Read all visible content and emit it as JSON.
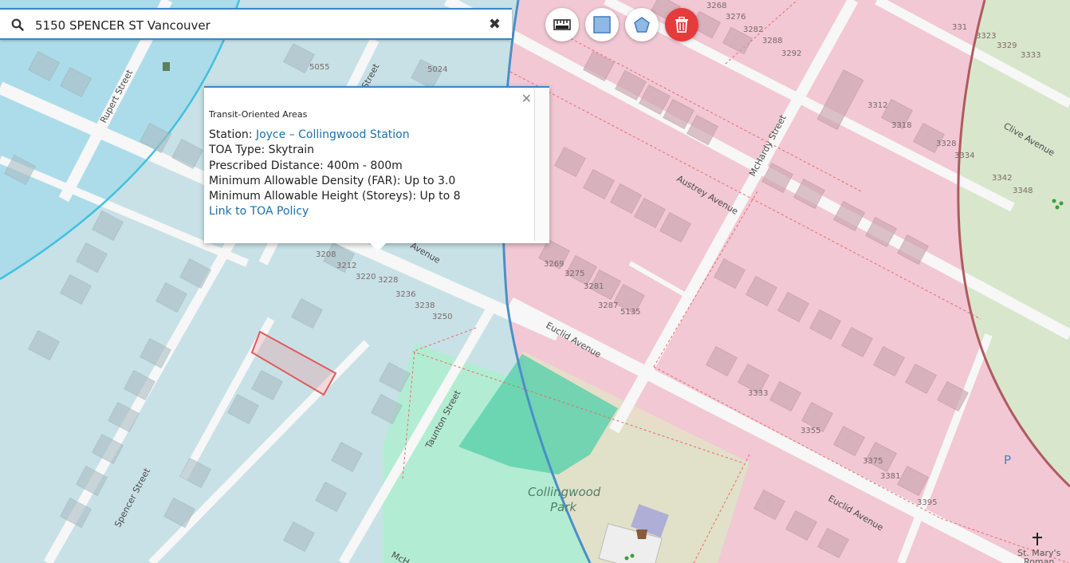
{
  "search": {
    "value": "5150 SPENCER ST Vancouver",
    "placeholder": ""
  },
  "toolbar": {
    "measure_icon": "ruler-icon",
    "rectangle_icon": "square-icon",
    "polygon_icon": "pentagon-icon",
    "delete_icon": "trash-icon"
  },
  "popup": {
    "title": "Transit-Oriented Areas",
    "station_label": "Station: ",
    "station_value": "Joyce – Collingwood Station",
    "toa_type": "TOA Type: Skytrain",
    "distance": "Prescribed Distance: 400m - 800m",
    "density": "Minimum Allowable Density (FAR): Up to 3.0",
    "height": "Minimum Allowable Height (Storeys): Up to 8",
    "link": "Link to TOA Policy"
  },
  "map_labels": {
    "rupert": "Rupert Street",
    "spencer": "Spencer Street",
    "taunton": "Taunton Street",
    "mchardy": "McHardy Street",
    "mchardy_cut": "McH",
    "street_cut": "Street",
    "austrey": "Austrey Avenue",
    "avenue_cut": "Avenue",
    "euclid1": "Euclid Avenue",
    "euclid2": "Euclid Avenue",
    "clive": "Clive Avenue",
    "park1": "Collingwood",
    "park2": "Park",
    "stmarys": "St. Mary's",
    "roman": "Roman",
    "parking": "P"
  },
  "address_numbers": {
    "n5055": "5055",
    "n5024": "5024",
    "n3268": "3268",
    "n3276": "3276",
    "n3282": "3282",
    "n3288": "3288",
    "n3292": "3292",
    "n331": "331",
    "n3312": "3312",
    "n3318": "3318",
    "n3328": "3328",
    "n3334": "3334",
    "n3342": "3342",
    "n3348": "3348",
    "n3323": "3323",
    "n3329": "3329",
    "n3333a": "3333",
    "n3208": "3208",
    "n3212": "3212",
    "n3220": "3220",
    "n3228": "3228",
    "n3236": "3236",
    "n3238": "3238",
    "n3250": "3250",
    "n3269": "3269",
    "n3275": "3275",
    "n3281": "3281",
    "n3287": "3287",
    "n5135": "5135",
    "n3333b": "3333",
    "n3355": "3355",
    "n3375": "3375",
    "n3381": "3381",
    "n3395": "3395"
  },
  "colors": {
    "toa_zone_blue": "#a8dbe9",
    "toa_zone_pink": "#f2c4d2",
    "toa_zone_green": "#d8e6cc",
    "park": "#aeefcf",
    "selected_parcel": "#e05a5a",
    "link": "#1e6fa8",
    "delete_button": "#e53b3b"
  }
}
